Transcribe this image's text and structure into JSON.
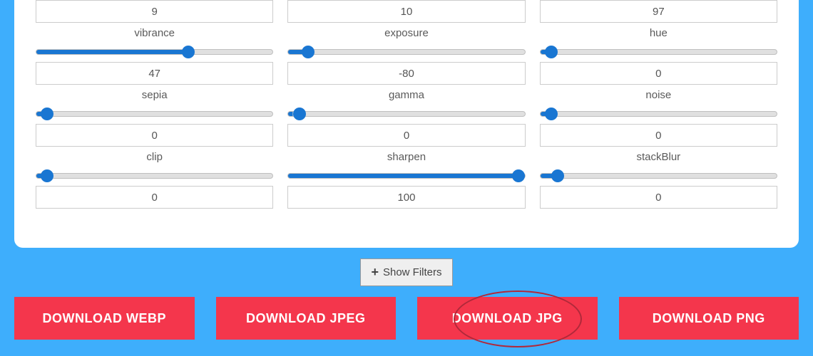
{
  "controls": [
    {
      "id": "vibrance",
      "label": "vibrance",
      "value": "9",
      "sliderValue": 9,
      "min": 0,
      "max": 100,
      "secondValue": "47",
      "second": 65,
      "sMin": 0,
      "sMax": 100
    },
    {
      "id": "exposure",
      "label": "exposure",
      "value": "10",
      "sliderValue": 6,
      "min": 0,
      "max": 100,
      "secondValue": "-80",
      "second": 2,
      "sMin": 0,
      "sMax": 100
    },
    {
      "id": "hue",
      "label": "hue",
      "value": "97",
      "sliderValue": 2,
      "min": 0,
      "max": 100,
      "secondValue": "0",
      "second": 2,
      "sMin": 0,
      "sMax": 100
    },
    {
      "id": "sepia",
      "label": "sepia"
    },
    {
      "id": "gamma",
      "label": "gamma"
    },
    {
      "id": "noise",
      "label": "noise"
    },
    {
      "id": "clip",
      "label": "clip",
      "sliderValue": 2,
      "min": 0,
      "max": 100,
      "secondValue": "0"
    },
    {
      "id": "sharpen",
      "label": "sharpen",
      "sliderValue": 100,
      "min": 0,
      "max": 100,
      "secondValue": "100"
    },
    {
      "id": "stackBlur",
      "label": "stackBlur",
      "sliderValue": 5,
      "min": 0,
      "max": 100,
      "secondValue": "0"
    }
  ],
  "r1": [
    {
      "label": "vibrance",
      "value": "9"
    },
    {
      "label": "exposure",
      "value": "10"
    },
    {
      "label": "hue",
      "value": "97"
    }
  ],
  "r1s": [
    {
      "pct": 65
    },
    {
      "pct": 6
    },
    {
      "pct": 2
    }
  ],
  "r2": [
    {
      "label": "sepia",
      "value": "47"
    },
    {
      "label": "gamma",
      "value": "-80"
    },
    {
      "label": "noise",
      "value": "0"
    }
  ],
  "r2s": [
    {
      "pct": 2
    },
    {
      "pct": 2
    },
    {
      "pct": 2
    }
  ],
  "r3": [
    {
      "label": "clip",
      "value": "0"
    },
    {
      "label": "sharpen",
      "value": "0"
    },
    {
      "label": "stackBlur",
      "value": "0"
    }
  ],
  "r3s": [
    {
      "pct": 2
    },
    {
      "pct": 100
    },
    {
      "pct": 5
    }
  ],
  "r4": [
    {
      "value": "0"
    },
    {
      "value": "100"
    },
    {
      "value": "0"
    }
  ],
  "showFilters": "Show Filters",
  "downloads": [
    "DOWNLOAD WEBP",
    "DOWNLOAD JPEG",
    "DOWNLOAD JPG",
    "DOWNLOAD PNG"
  ]
}
